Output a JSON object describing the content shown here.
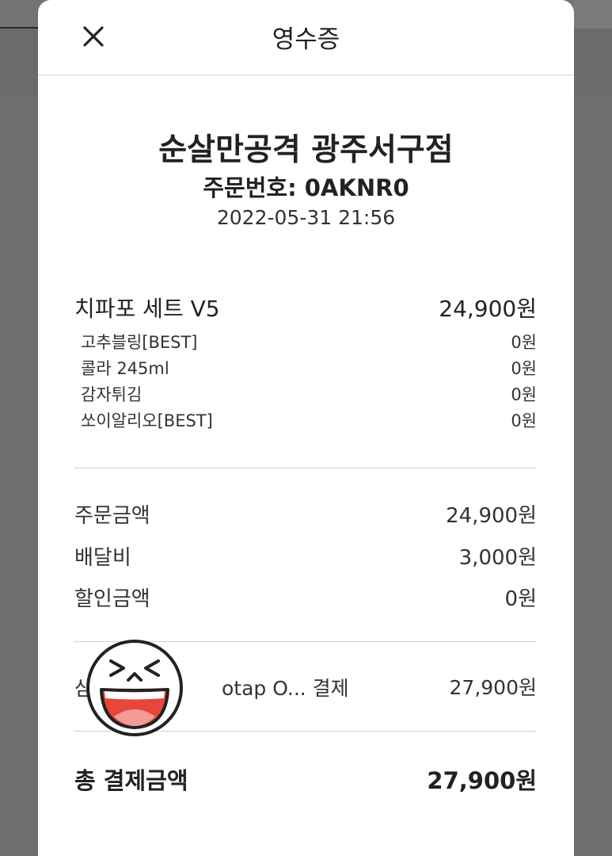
{
  "header": {
    "title": "영수증",
    "close_icon": "close-icon"
  },
  "store": {
    "name": "순살만공격 광주서구점",
    "order_number": "주문번호: 0AKNR0",
    "order_datetime": "2022-05-31 21:56"
  },
  "items": {
    "main": {
      "name": "치파포 세트 V5",
      "price": "24,900원"
    },
    "options": [
      {
        "name": "고추블링[BEST]",
        "price": "0원"
      },
      {
        "name": "콜라 245ml",
        "price": "0원"
      },
      {
        "name": "감자튀김",
        "price": "0원"
      },
      {
        "name": "쏘이알리오[BEST]",
        "price": "0원"
      }
    ]
  },
  "summary": {
    "order_amount_label": "주문금액",
    "order_amount": "24,900원",
    "delivery_fee_label": "배달비",
    "delivery_fee": "3,000원",
    "discount_label": "할인금액",
    "discount": "0원"
  },
  "payment": {
    "method_prefix": "삼",
    "method_suffix": "otap O... 결제",
    "amount": "27,900원"
  },
  "total": {
    "label": "총 결제금액",
    "amount": "27,900원"
  },
  "overlay": {
    "sticker_icon": "laughing-face-icon"
  }
}
